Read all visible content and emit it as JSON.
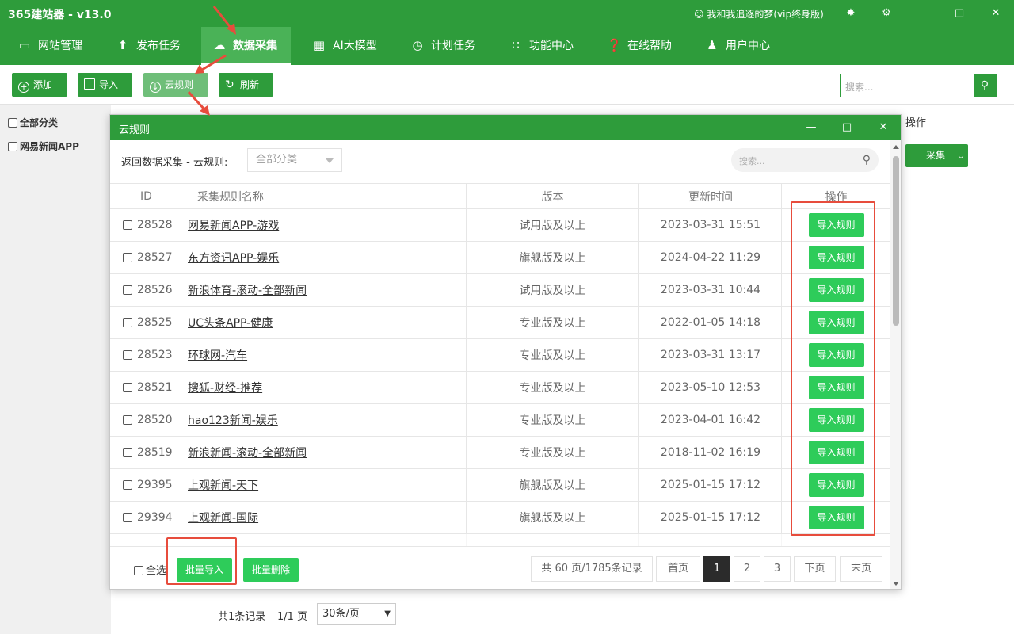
{
  "window": {
    "title": "365建站器 - v13.0",
    "user": "我和我追逐的梦(vip终身版)",
    "controls": {
      "skin": "skin-icon",
      "settings": "gear-icon",
      "minimize": "minimize-icon",
      "maximize": "maximize-icon",
      "close": "close-icon"
    }
  },
  "nav": [
    {
      "label": "网站管理",
      "icon": "site-icon"
    },
    {
      "label": "发布任务",
      "icon": "upload-icon"
    },
    {
      "label": "数据采集",
      "icon": "cloud-download-icon",
      "active": true
    },
    {
      "label": "AI大模型",
      "icon": "robot-icon"
    },
    {
      "label": "计划任务",
      "icon": "clock-icon"
    },
    {
      "label": "功能中心",
      "icon": "grid-icon"
    },
    {
      "label": "在线帮助",
      "icon": "help-icon"
    },
    {
      "label": "用户中心",
      "icon": "user-icon"
    }
  ],
  "toolbar": {
    "add": "添加",
    "import": "导入",
    "cloud_rules": "云规则",
    "refresh": "刷新",
    "search_placeholder": "搜索..."
  },
  "sidebar": {
    "all": "全部分类",
    "item1": "网易新闻APP"
  },
  "background": {
    "op_header": "操作",
    "collect": "采集",
    "records": "共1条记录",
    "pages": "1/1 页",
    "page_size": "30条/页"
  },
  "modal": {
    "title": "云规则",
    "filter_label": "返回数据采集 - 云规则:",
    "category_select": "全部分类",
    "search_placeholder": "搜索...",
    "columns": {
      "id": "ID",
      "name": "采集规则名称",
      "version": "版本",
      "updated": "更新时间",
      "action": "操作"
    },
    "rows": [
      {
        "id": "28528",
        "name": "网易新闻APP-游戏",
        "version": "试用版及以上",
        "updated": "2023-03-31 15:51",
        "action": "导入规则"
      },
      {
        "id": "28527",
        "name": "东方资讯APP-娱乐",
        "version": "旗舰版及以上",
        "updated": "2024-04-22 11:29",
        "action": "导入规则"
      },
      {
        "id": "28526",
        "name": "新浪体育-滚动-全部新闻",
        "version": "试用版及以上",
        "updated": "2023-03-31 10:44",
        "action": "导入规则"
      },
      {
        "id": "28525",
        "name": "UC头条APP-健康",
        "version": "专业版及以上",
        "updated": "2022-01-05 14:18",
        "action": "导入规则"
      },
      {
        "id": "28523",
        "name": "环球网-汽车",
        "version": "专业版及以上",
        "updated": "2023-03-31 13:17",
        "action": "导入规则"
      },
      {
        "id": "28521",
        "name": "搜狐-财经-推荐",
        "version": "专业版及以上",
        "updated": "2023-05-10 12:53",
        "action": "导入规则"
      },
      {
        "id": "28520",
        "name": "hao123新闻-娱乐",
        "version": "专业版及以上",
        "updated": "2023-04-01 16:42",
        "action": "导入规则"
      },
      {
        "id": "28519",
        "name": "新浪新闻-滚动-全部新闻",
        "version": "专业版及以上",
        "updated": "2018-11-02 16:19",
        "action": "导入规则"
      },
      {
        "id": "29395",
        "name": "上观新闻-天下",
        "version": "旗舰版及以上",
        "updated": "2025-01-15 17:12",
        "action": "导入规则"
      },
      {
        "id": "29394",
        "name": "上观新闻-国际",
        "version": "旗舰版及以上",
        "updated": "2025-01-15 17:12",
        "action": "导入规则"
      }
    ],
    "footer": {
      "select_all": "全选",
      "batch_import": "批量导入",
      "batch_delete": "批量删除",
      "page_info": "共 60 页/1785条记录",
      "first": "首页",
      "pages": [
        "1",
        "2",
        "3"
      ],
      "current_page": "1",
      "next": "下页",
      "last": "末页"
    }
  },
  "colors": {
    "primary": "#2e9c3b",
    "button": "#2ecc5a",
    "annotation": "#e74c3c"
  }
}
